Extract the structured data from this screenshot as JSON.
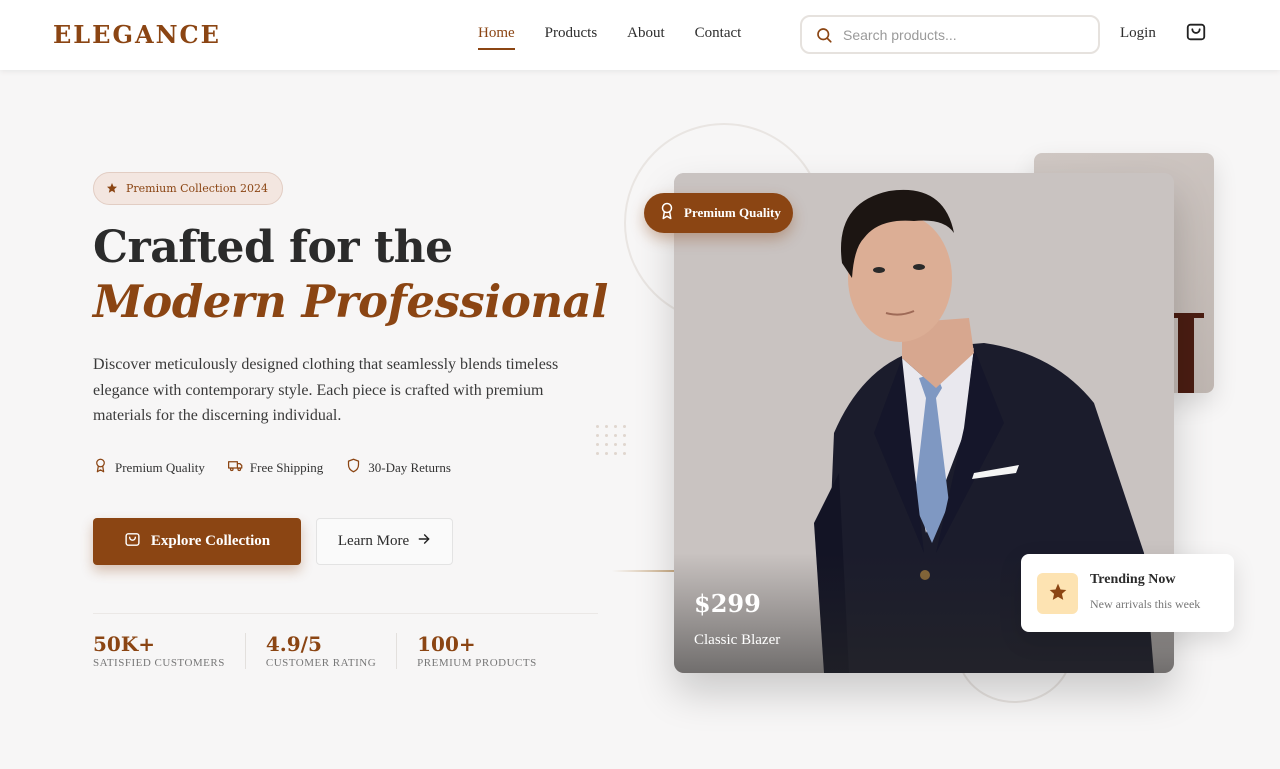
{
  "brand": {
    "logo": "ELEGANCE",
    "accent_color": "#8b4513"
  },
  "nav": {
    "items": [
      {
        "label": "Home",
        "active": true
      },
      {
        "label": "Products",
        "active": false
      },
      {
        "label": "About",
        "active": false
      },
      {
        "label": "Contact",
        "active": false
      }
    ]
  },
  "search": {
    "placeholder": "Search products...",
    "value": "",
    "icon": "search-icon"
  },
  "header": {
    "login_label": "Login",
    "cart_icon": "shopping-bag-icon"
  },
  "hero": {
    "badge": "Premium Collection 2024",
    "title_line1": "Crafted for the",
    "title_line2": "Modern Professional",
    "description": "Discover meticulously designed clothing that seamlessly blends timeless elegance with contemporary style. Each piece is crafted with premium materials for the discerning individual.",
    "features": [
      {
        "label": "Premium Quality",
        "icon": "award-icon"
      },
      {
        "label": "Free Shipping",
        "icon": "truck-icon"
      },
      {
        "label": "30-Day Returns",
        "icon": "shield-icon"
      }
    ],
    "primary_cta": "Explore Collection",
    "secondary_cta": "Learn More",
    "stats": [
      {
        "value": "50K+",
        "label": "SATISFIED CUSTOMERS"
      },
      {
        "value": "4.9/5",
        "label": "CUSTOMER RATING"
      },
      {
        "value": "100+",
        "label": "PREMIUM PRODUCTS"
      }
    ]
  },
  "product_card": {
    "pill": "Premium Quality",
    "price": "$299",
    "name": "Classic Blazer"
  },
  "trending": {
    "title": "Trending Now",
    "subtitle": "New arrivals this week",
    "icon_bg": "#fde3b2"
  }
}
